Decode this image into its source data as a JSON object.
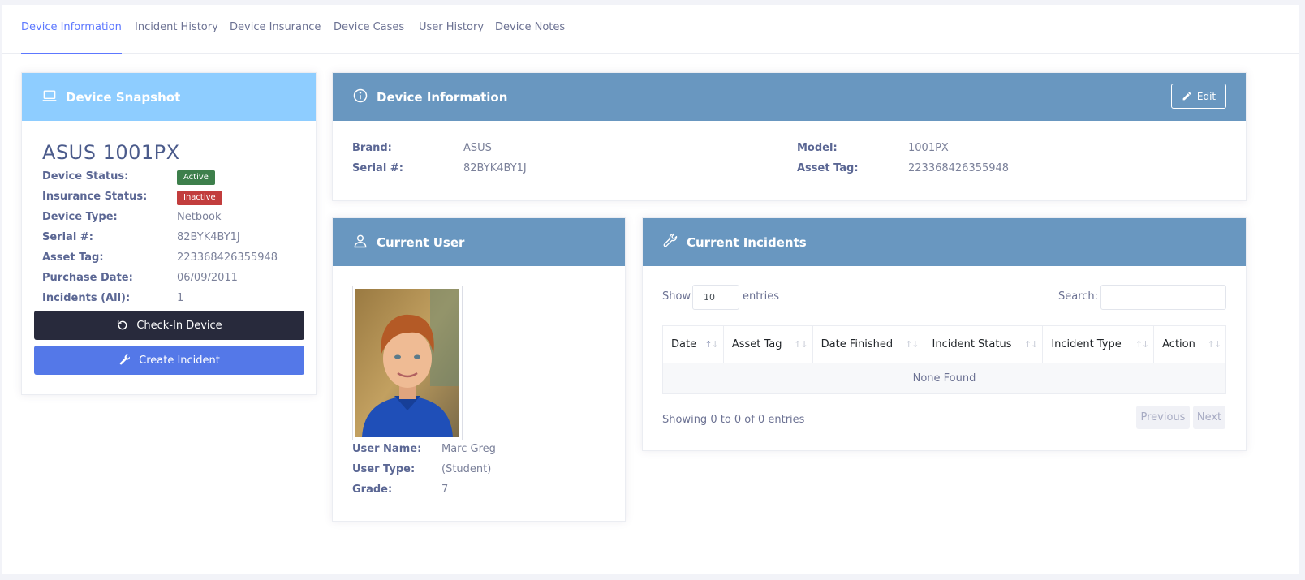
{
  "tabs": [
    "Device Information",
    "Incident History",
    "Device Insurance",
    "Device Cases",
    "User History",
    "Device Notes"
  ],
  "snapshot": {
    "header": "Device Snapshot",
    "title": "ASUS 1001PX",
    "device_status_label": "Device Status:",
    "device_status": "Active",
    "insurance_status_label": "Insurance Status:",
    "insurance_status": "Inactive",
    "device_type_label": "Device Type:",
    "device_type": "Netbook",
    "serial_label": "Serial #:",
    "serial": "82BYK4BY1J",
    "asset_tag_label": "Asset Tag:",
    "asset_tag": "223368426355948",
    "purchase_date_label": "Purchase Date:",
    "purchase_date": "06/09/2011",
    "incidents_label": "Incidents (All):",
    "incidents": "1",
    "checkin_button": "Check-In Device",
    "create_incident_button": "Create Incident"
  },
  "device_info": {
    "header": "Device Information",
    "edit_button": "Edit",
    "brand_label": "Brand:",
    "brand": "ASUS",
    "serial_label": "Serial #:",
    "serial": "82BYK4BY1J",
    "model_label": "Model:",
    "model": "1001PX",
    "asset_tag_label": "Asset Tag:",
    "asset_tag": "223368426355948"
  },
  "current_user": {
    "header": "Current User",
    "user_name_label": "User Name:",
    "user_name": "Marc Greg",
    "user_type_label": "User Type:",
    "user_type": "(Student)",
    "grade_label": "Grade:",
    "grade": "7"
  },
  "incidents": {
    "header": "Current Incidents",
    "show_label": "Show",
    "page_size": "10",
    "entries_label": "entries",
    "search_label": "Search:",
    "search_value": "",
    "columns": [
      "Date",
      "Asset Tag",
      "Date Finished",
      "Incident Status",
      "Incident Type",
      "Action"
    ],
    "empty_text": "None Found",
    "info_text": "Showing 0 to 0 of 0 entries",
    "previous_label": "Previous",
    "next_label": "Next"
  },
  "colors": {
    "accent": "#5d78ff",
    "snapshot_header": "#8ecdff",
    "panel_header": "#6997c0",
    "active_badge": "#3d7f4b",
    "inactive_badge": "#c23d3d",
    "dark_button": "#282a3c",
    "blue_button": "#5478e8"
  },
  "icons": {
    "snapshot": "laptop-icon",
    "device_info": "info-circle-icon",
    "edit": "pencil-icon",
    "current_user": "user-icon",
    "incidents": "wrench-icon",
    "checkin": "undo-icon",
    "create_incident": "wrench-icon"
  }
}
